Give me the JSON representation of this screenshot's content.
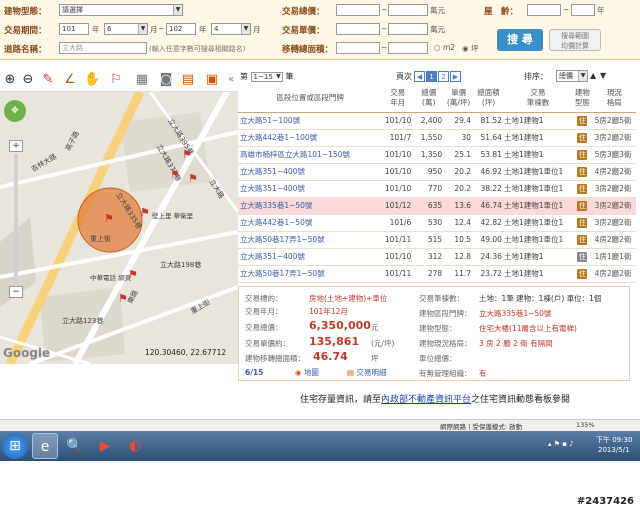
{
  "form": {
    "building_type_label": "建物型態：",
    "building_type_value": "請選擇",
    "period_label": "交易期間：",
    "from_year": "101",
    "from_month": "6",
    "to_year": "102",
    "to_month": "4",
    "year_unit": "年",
    "month_unit": "月",
    "tilde": "~",
    "road_label": "道路名稱：",
    "road_value": "立大路",
    "road_hint": "(輸入任意字數可搜尋相關路名)",
    "total_price_label": "交易總價：",
    "price_unit": "萬元",
    "unit_price_label": "交易單價：",
    "area_label": "移轉總面積：",
    "area_unit_m2": "m2",
    "area_unit_ping": "坪",
    "age_label": "屋　齡：",
    "age_unit": "年",
    "search_button": "搜 尋",
    "calc_button_line1": "搜尋範圍",
    "calc_button_line2": "均價計算"
  },
  "map": {
    "streets": [
      "立大路395巷",
      "立大路377巷",
      "高子路",
      "吉林大路",
      "立大路335巷",
      "重上街",
      "立大路198巷",
      "立大路123巷",
      "重上街",
      "樂路",
      "立大路"
    ],
    "poi": [
      "壁上里\n華衛里",
      "中華電話\n網頁"
    ],
    "coordinates": "120.30460, 22.67712",
    "google_label": "Google"
  },
  "results": {
    "per_page_prefix": "第",
    "per_page_value": "1~15",
    "per_page_suffix": "筆",
    "page_label": "頁次",
    "pages": [
      "1",
      "2"
    ],
    "sort_label": "排序：",
    "sort_value": "總價",
    "columns": {
      "address": "區段位置或區段門牌",
      "date_l1": "交易",
      "date_l2": "年月",
      "total_l1": "總價",
      "total_l2": "(萬)",
      "unit_l1": "單價",
      "unit_l2": "(萬/坪)",
      "area_l1": "總面積",
      "area_l2": "(坪)",
      "target_l1": "交易",
      "target_l2": "筆棟數",
      "type_l1": "建物",
      "type_l2": "型態",
      "layout_l1": "現況",
      "layout_l2": "格局"
    },
    "rows": [
      {
        "address": "立大路51~100號",
        "date": "101/10",
        "total": "2,400",
        "unit": "29.4",
        "area": "81.52",
        "target": "土地1建物1",
        "type": "住",
        "layout": "5房2廳5衛"
      },
      {
        "address": "立大路442巷1~100號",
        "date": "101/7",
        "total": "1,550",
        "unit": "30",
        "area": "51.64",
        "target": "土地1建物1",
        "type": "住",
        "layout": "3房2廳2衛"
      },
      {
        "address": "高雄市楠梓區立大路101~150號",
        "date": "101/10",
        "total": "1,350",
        "unit": "25.1",
        "area": "53.81",
        "target": "土地1建物1",
        "type": "住",
        "layout": "5房3廳3衛"
      },
      {
        "address": "立大路351~400號",
        "date": "101/10",
        "total": "950",
        "unit": "20.2",
        "area": "46.92",
        "target": "土地1建物1車位1",
        "type": "住",
        "layout": "4房2廳2衛"
      },
      {
        "address": "立大路351~400號",
        "date": "101/10",
        "total": "770",
        "unit": "20.2",
        "area": "38.22",
        "target": "土地1建物1車位1",
        "type": "住",
        "layout": "3房2廳2衛"
      },
      {
        "address": "立大路335巷1~50號",
        "date": "101/12",
        "total": "635",
        "unit": "13.6",
        "area": "46.74",
        "target": "土地1建物1車位1",
        "type": "住",
        "layout": "3房2廳2衛"
      },
      {
        "address": "立大路442巷1~50號",
        "date": "101/6",
        "total": "530",
        "unit": "12.4",
        "area": "42.82",
        "target": "土地1建物1車位1",
        "type": "住",
        "layout": "3房2廳2衛"
      },
      {
        "address": "立大路50巷17弄1~50號",
        "date": "101/11",
        "total": "515",
        "unit": "10.5",
        "area": "49.00",
        "target": "土地1建物1車位1",
        "type": "住",
        "layout": "4房2廳2衛"
      },
      {
        "address": "立大路351~400號",
        "date": "101/10",
        "total": "312",
        "unit": "12.8",
        "area": "24.36",
        "target": "土地1建物1",
        "type": "住",
        "layout": "1房1廳1衛"
      },
      {
        "address": "立大路50巷17弄1~50號",
        "date": "101/11",
        "total": "278",
        "unit": "11.7",
        "area": "23.72",
        "target": "土地1建物1",
        "type": "住",
        "layout": "4房2廳2衛"
      }
    ]
  },
  "detail": {
    "target_label": "交易標的：",
    "target_value": "房地(土地+建物)+車位",
    "date_label": "交易年月：",
    "date_value": "101年12月",
    "total_label": "交易總價：",
    "total_value": "6,350,000",
    "total_unit": "元",
    "unit_label": "交易單價約：",
    "unit_value": "135,861",
    "unit_unit": "(元/坪)",
    "area_label": "建物移轉總面積：",
    "area_value": "46.74",
    "area_unit": "坪",
    "count_label": "交易筆棟數：",
    "count_value": "土地：1筆 建物：1棟(戶) 車位：1個",
    "addr_label": "建物區段門牌：",
    "addr_value": "立大路335巷1~50號",
    "btype_label": "建物型態：",
    "btype_value": "住宅大樓(11層含以上有電梯)",
    "layout_label": "建物現況格局：",
    "layout_value": "3 房 2 廳 2 衛 有隔間",
    "parking_label": "車位總價：",
    "parking_value": "",
    "mgmt_label": "有無管理組織：",
    "mgmt_value": "有",
    "index": "6/15",
    "map_button": "地圖",
    "info_button": "交易明細"
  },
  "footer": {
    "prefix": "住宅存量資訊，請至",
    "link": "內政部不動產資訊平台",
    "suffix": "之住宅資訊動態看板參閱"
  },
  "taskbar": {
    "zone_text": "網際網路 | 受保護模式: 啟動",
    "zoom": "135%",
    "time": "下午 09:30",
    "date": "2013/5/1"
  },
  "watermark": "#2437426"
}
